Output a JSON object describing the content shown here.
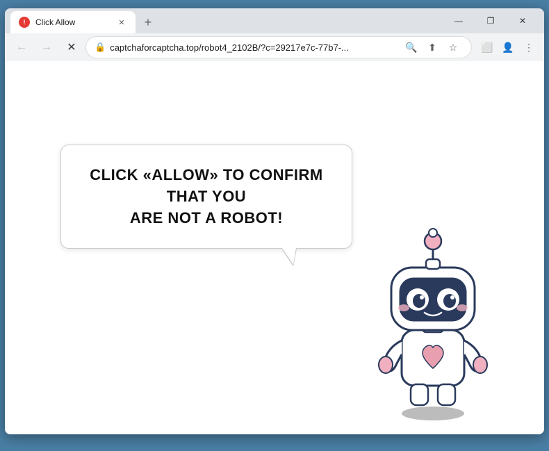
{
  "browser": {
    "title_bar": {
      "tab_title": "Click Allow",
      "new_tab_label": "+",
      "window_controls": {
        "minimize": "—",
        "maximize": "❐",
        "close": "✕"
      }
    },
    "nav_bar": {
      "back_label": "←",
      "forward_label": "→",
      "reload_label": "✕",
      "url": "captchaforcaptcha.top/robot4_2102B/?c=29217e7c-77b7-...",
      "search_icon": "🔍",
      "share_icon": "⬆",
      "bookmark_icon": "☆",
      "extensions_icon": "⬜",
      "profile_icon": "👤",
      "menu_icon": "⋮"
    },
    "page": {
      "bubble_line1": "CLICK «ALLOW» TO CONFIRM THAT YOU",
      "bubble_line2": "ARE NOT A ROBOT!"
    }
  }
}
